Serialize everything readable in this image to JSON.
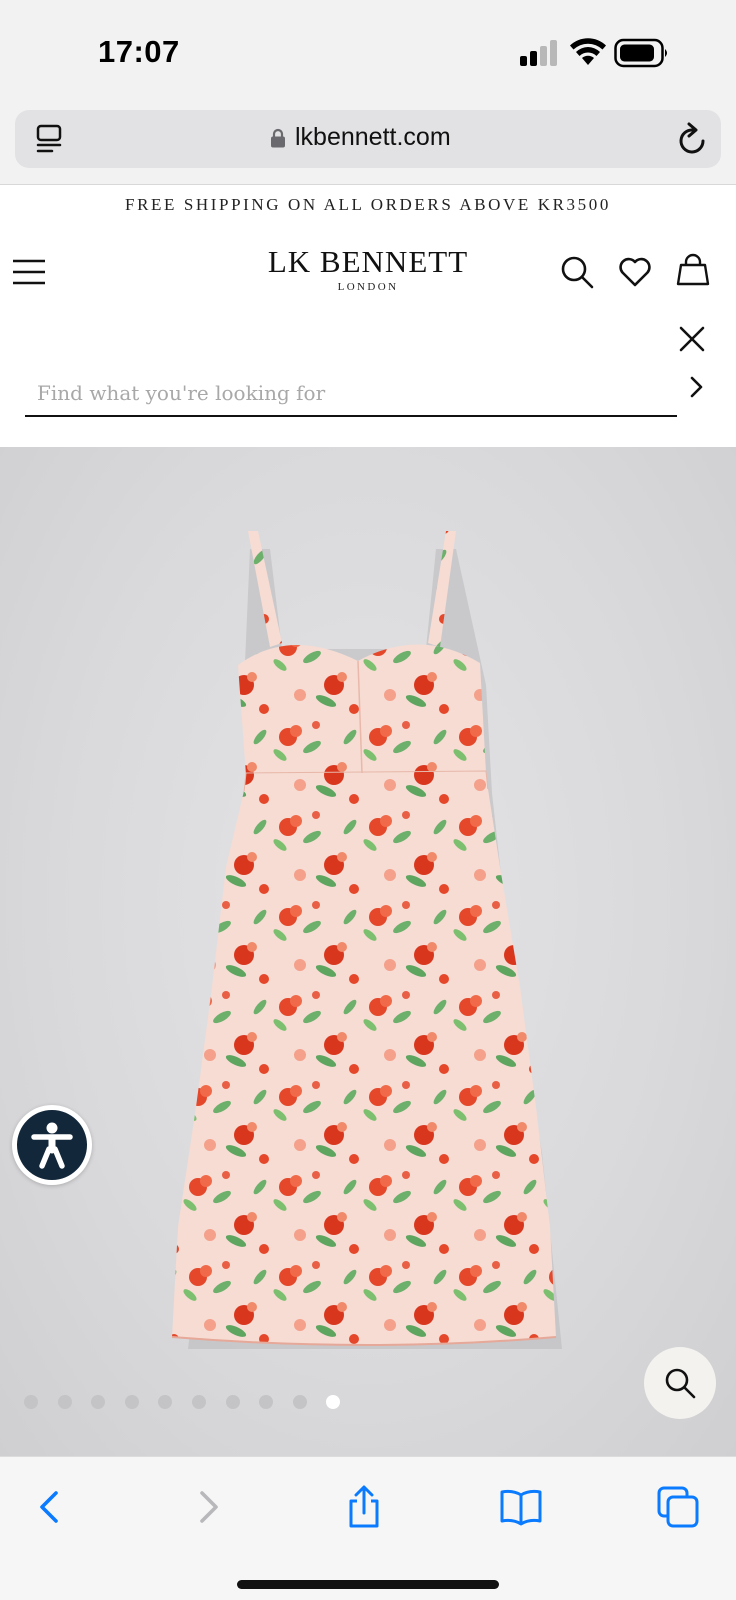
{
  "status_bar": {
    "time": "17:07"
  },
  "browser": {
    "url": "lkbennett.com"
  },
  "site": {
    "promo_banner": "FREE SHIPPING ON ALL ORDERS ABOVE KR3500",
    "logo": {
      "name": "LK BENNETT",
      "sub": "LONDON"
    },
    "search": {
      "placeholder": "Find what you're looking for",
      "value": ""
    },
    "gallery": {
      "image_count": 10,
      "active_index": 9
    }
  },
  "colors": {
    "accessibility_bg": "#13273a",
    "browser_accent": "#0a7aff",
    "dress_base": "#f6dcd3",
    "print_red": "#e4472a",
    "print_green": "#6db06c"
  },
  "icons": {
    "status": [
      "signal-icon",
      "wifi-icon",
      "battery-icon"
    ],
    "header": [
      "menu-icon",
      "search-icon",
      "heart-icon",
      "bag-icon"
    ],
    "search": [
      "close-icon",
      "chevron-right-icon"
    ],
    "toolbar": [
      "back-icon",
      "forward-icon",
      "share-icon",
      "bookmarks-icon",
      "tabs-icon"
    ]
  }
}
